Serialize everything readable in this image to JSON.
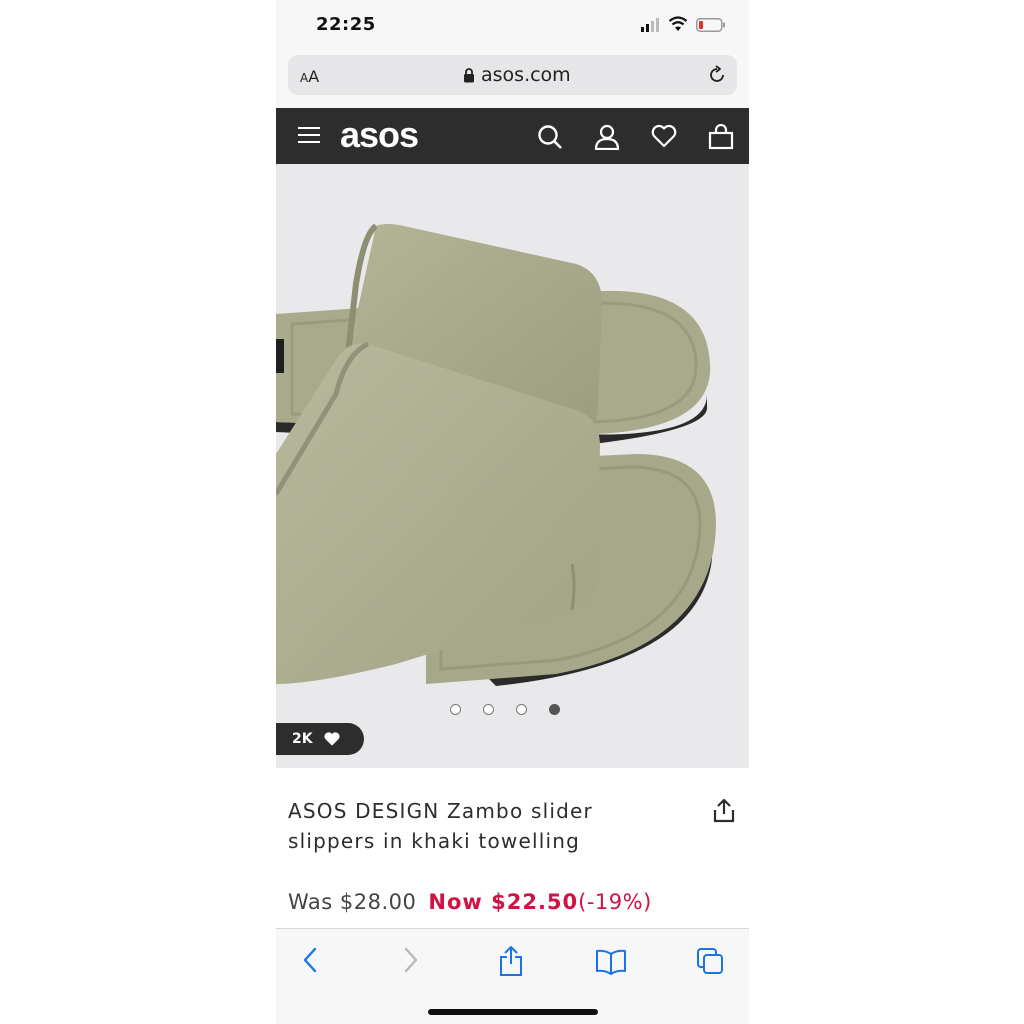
{
  "status": {
    "time": "22:25"
  },
  "browser": {
    "text_size_label": "AA",
    "url": "asos.com"
  },
  "product": {
    "title": "ASOS DESIGN Zambo slider slippers in khaki towelling",
    "saves_count": "2K",
    "was_price": "Was $28.00",
    "now_price": "Now $22.50",
    "discount": "(-19%)",
    "image_count": 4,
    "active_image_index": 3
  },
  "header": {
    "logo_text": "asos"
  },
  "colors": {
    "header_bg": "#2d2d2d",
    "sale_red": "#d01345",
    "ios_blue": "#1a73e8"
  },
  "icons": [
    "signal-icon",
    "wifi-icon",
    "battery-icon",
    "lock-icon",
    "reload-icon",
    "menu-icon",
    "search-icon",
    "account-icon",
    "heart-icon",
    "bag-icon",
    "share-icon",
    "back-icon",
    "forward-icon",
    "ios-share-icon",
    "bookmarks-icon",
    "tabs-icon"
  ]
}
